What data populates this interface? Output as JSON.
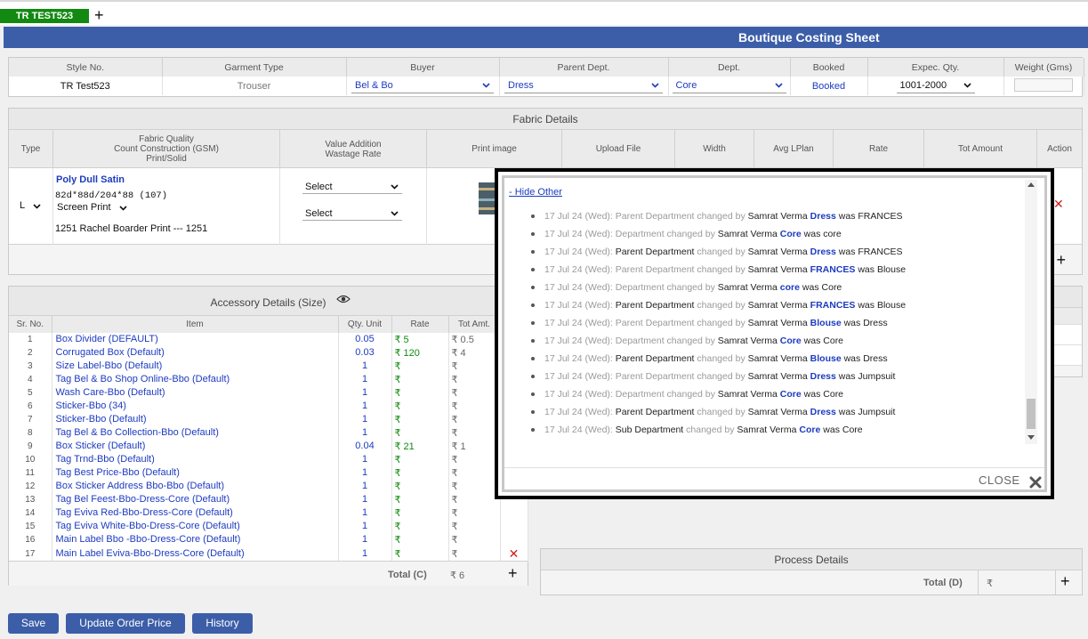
{
  "tabs": {
    "active": "TR TEST523",
    "add": "+"
  },
  "page_title": "Boutique Costing Sheet",
  "style": {
    "headers": [
      "Style No.",
      "Garment Type",
      "Buyer",
      "Parent Dept.",
      "Dept.",
      "Booked",
      "Expec. Qty.",
      "Weight (Gms)"
    ],
    "style_no": "TR Test523",
    "garment_type": "Trouser",
    "buyer": "Bel & Bo",
    "parent_dept": "Dress",
    "dept": "Core",
    "booked": "Booked",
    "expec_qty": "1001-2000",
    "weight": ""
  },
  "fabric": {
    "title": "Fabric Details",
    "headers": {
      "type": "Type",
      "fabric_quality": "Fabric Quality",
      "count_construction": "Count Construction (GSM)",
      "print_solid": "Print/Solid",
      "value_addition": "Value Addition",
      "wastage_rate": "Wastage Rate",
      "print_image": "Print image",
      "upload_file": "Upload File",
      "width": "Width",
      "avg_lplan": "Avg LPlan",
      "rate": "Rate",
      "tot_amount": "Tot Amount",
      "action": "Action"
    },
    "row": {
      "type": "L",
      "quality": "Poly Dull Satin",
      "construction": "82d*88d/204*88  (107)",
      "print_type": "Screen Print",
      "print_name": "1251 Rachel Boarder Print --- 1251",
      "value_addition": "Select",
      "wastage_rate": "Select"
    },
    "add": "+"
  },
  "accessory": {
    "title": "Accessory Details (Size)",
    "headers": [
      "Sr. No.",
      "Item",
      "Qty. Unit",
      "Rate",
      "Tot Amt."
    ],
    "currency": "₹",
    "rows": [
      {
        "sr": "1",
        "item": "Box Divider (DEFAULT)",
        "qty": "0.05",
        "rate": "₹ 5",
        "amt": "₹ 0.5"
      },
      {
        "sr": "2",
        "item": "Corrugated Box (Default)",
        "qty": "0.03",
        "rate": "₹ 120",
        "amt": "₹ 4"
      },
      {
        "sr": "3",
        "item": "Size Label-Bbo (Default)",
        "qty": "1",
        "rate": "₹",
        "amt": "₹"
      },
      {
        "sr": "4",
        "item": "Tag Bel & Bo Shop Online-Bbo (Default)",
        "qty": "1",
        "rate": "₹",
        "amt": "₹"
      },
      {
        "sr": "5",
        "item": "Wash Care-Bbo (Default)",
        "qty": "1",
        "rate": "₹",
        "amt": "₹"
      },
      {
        "sr": "6",
        "item": "Sticker-Bbo (34)",
        "qty": "1",
        "rate": "₹",
        "amt": "₹"
      },
      {
        "sr": "7",
        "item": "Sticker-Bbo (Default)",
        "qty": "1",
        "rate": "₹",
        "amt": "₹"
      },
      {
        "sr": "8",
        "item": "Tag Bel & Bo Collection-Bbo (Default)",
        "qty": "1",
        "rate": "₹",
        "amt": "₹"
      },
      {
        "sr": "9",
        "item": "Box Sticker (Default)",
        "qty": "0.04",
        "rate": "₹ 21",
        "amt": "₹ 1"
      },
      {
        "sr": "10",
        "item": "Tag Trnd-Bbo (Default)",
        "qty": "1",
        "rate": "₹",
        "amt": "₹"
      },
      {
        "sr": "11",
        "item": "Tag Best Price-Bbo (Default)",
        "qty": "1",
        "rate": "₹",
        "amt": "₹"
      },
      {
        "sr": "12",
        "item": "Box Sticker Address Bbo-Bbo (Default)",
        "qty": "1",
        "rate": "₹",
        "amt": "₹"
      },
      {
        "sr": "13",
        "item": "Tag Bel Feest-Bbo-Dress-Core (Default)",
        "qty": "1",
        "rate": "₹",
        "amt": "₹"
      },
      {
        "sr": "14",
        "item": "Tag Eviva Red-Bbo-Dress-Core (Default)",
        "qty": "1",
        "rate": "₹",
        "amt": "₹"
      },
      {
        "sr": "15",
        "item": "Tag Eviva White-Bbo-Dress-Core (Default)",
        "qty": "1",
        "rate": "₹",
        "amt": "₹"
      },
      {
        "sr": "16",
        "item": "Main Label Bbo -Bbo-Dress-Core (Default)",
        "qty": "1",
        "rate": "₹",
        "amt": "₹"
      },
      {
        "sr": "17",
        "item": "Main Label Eviva-Bbo-Dress-Core (Default)",
        "qty": "1",
        "rate": "₹",
        "amt": "₹"
      }
    ],
    "total_label": "Total (C)",
    "total_value": "₹ 6",
    "add": "+"
  },
  "process": {
    "title": "Process Details",
    "total_label": "Total (D)",
    "total_value": "₹",
    "add": "+"
  },
  "buttons": {
    "save": "Save",
    "update_order_price": "Update Order Price",
    "history": "History"
  },
  "history_modal": {
    "hide_other": "- Hide Other",
    "close": "CLOSE",
    "entries": [
      {
        "date": "17 Jul 24 (Wed):",
        "field": "Parent Department",
        "field_dark": false,
        "changed_by": "changed by",
        "user": "Samrat Verma",
        "new": "Dress",
        "was": "was",
        "old": "FRANCES"
      },
      {
        "date": "17 Jul 24 (Wed):",
        "field": "Department",
        "field_dark": false,
        "changed_by": "changed by",
        "user": "Samrat Verma",
        "new": "Core",
        "was": "was",
        "old": "core"
      },
      {
        "date": "17 Jul 24 (Wed):",
        "field": "Parent Department",
        "field_dark": true,
        "changed_by": "changed by",
        "user": "Samrat Verma",
        "new": "Dress",
        "was": "was",
        "old": "FRANCES"
      },
      {
        "date": "17 Jul 24 (Wed):",
        "field": "Parent Department",
        "field_dark": false,
        "changed_by": "changed by",
        "user": "Samrat Verma",
        "new": "FRANCES",
        "was": "was",
        "old": "Blouse"
      },
      {
        "date": "17 Jul 24 (Wed):",
        "field": "Department",
        "field_dark": false,
        "changed_by": "changed by",
        "user": "Samrat Verma",
        "new": "core",
        "was": "was",
        "old": "Core"
      },
      {
        "date": "17 Jul 24 (Wed):",
        "field": "Parent Department",
        "field_dark": true,
        "changed_by": "changed by",
        "user": "Samrat Verma",
        "new": "FRANCES",
        "was": "was",
        "old": "Blouse"
      },
      {
        "date": "17 Jul 24 (Wed):",
        "field": "Parent Department",
        "field_dark": false,
        "changed_by": "changed by",
        "user": "Samrat Verma",
        "new": "Blouse",
        "was": "was",
        "old": "Dress"
      },
      {
        "date": "17 Jul 24 (Wed):",
        "field": "Department",
        "field_dark": false,
        "changed_by": "changed by",
        "user": "Samrat Verma",
        "new": "Core",
        "was": "was",
        "old": "Core"
      },
      {
        "date": "17 Jul 24 (Wed):",
        "field": "Parent Department",
        "field_dark": true,
        "changed_by": "changed by",
        "user": "Samrat Verma",
        "new": "Blouse",
        "was": "was",
        "old": "Dress"
      },
      {
        "date": "17 Jul 24 (Wed):",
        "field": "Parent Department",
        "field_dark": false,
        "changed_by": "changed by",
        "user": "Samrat Verma",
        "new": "Dress",
        "was": "was",
        "old": "Jumpsuit"
      },
      {
        "date": "17 Jul 24 (Wed):",
        "field": "Department",
        "field_dark": false,
        "changed_by": "changed by",
        "user": "Samrat Verma",
        "new": "Core",
        "was": "was",
        "old": "Core"
      },
      {
        "date": "17 Jul 24 (Wed):",
        "field": "Parent Department",
        "field_dark": true,
        "changed_by": "changed by",
        "user": "Samrat Verma",
        "new": "Dress",
        "was": "was",
        "old": "Jumpsuit"
      },
      {
        "date": "17 Jul 24 (Wed):",
        "field": "Sub Department",
        "field_dark": true,
        "changed_by": "changed by",
        "user": "Samrat Verma",
        "new": "Core",
        "was": "was",
        "old": "Core"
      }
    ]
  },
  "colors": {
    "primary": "#3c5ea8",
    "tab_active": "#128a12",
    "link": "#1d3bc0",
    "rate_green": "#0d8a0d",
    "delete_red": "#d02020"
  },
  "icons": {
    "eye": "eye-icon",
    "close": "close-x-icon",
    "delete": "delete-x-icon",
    "dropdown": "chevron-down-icon"
  }
}
